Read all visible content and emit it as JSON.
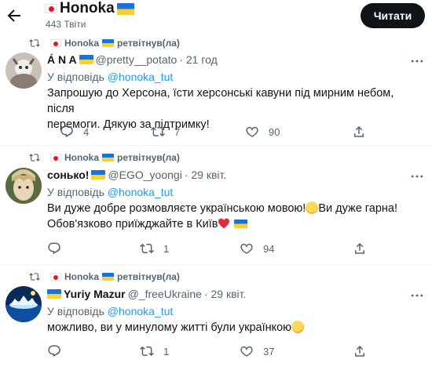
{
  "header": {
    "title": "Honoka",
    "tweet_count": "443 Твіти",
    "follow_label": "Читати"
  },
  "retweeter_name": "Honoka",
  "retweeted_label": "ретвітнув(ла)",
  "reply_prefix": "У відповідь",
  "reply_handle": "@honoka_tut",
  "tweets": [
    {
      "name": "Á N A",
      "handle": "@pretty__potato",
      "time": "· 21 год",
      "text_1": "Запрошую до Херсона, їсти херсонські кавуни під мирним небом, після",
      "text_2": "перемоги. Дякую за підтримку!",
      "replies": "4",
      "retweets": "7",
      "likes": "90"
    },
    {
      "name": "сонько!",
      "handle": "@EGO_yoongi",
      "time": "· 29 квіт.",
      "text_1": "Ви дуже добре розмовляєте українською мовою!",
      "text_1b": "Ви дуже гарна!",
      "text_2": "Обов'язково приїжджайте в Київ",
      "replies": "",
      "retweets": "1",
      "likes": "94"
    },
    {
      "name": "Yuriy Mazur",
      "handle": "@_freeUkraine",
      "time": "· 29 квіт.",
      "text_1": "можливо, ви у минулому житті були українкою",
      "replies": "",
      "retweets": "1",
      "likes": "37"
    }
  ],
  "colors": {
    "accent": "#1d9bf0",
    "text": "#0f1419",
    "muted": "#536471",
    "follow_bg": "#0f1419"
  }
}
